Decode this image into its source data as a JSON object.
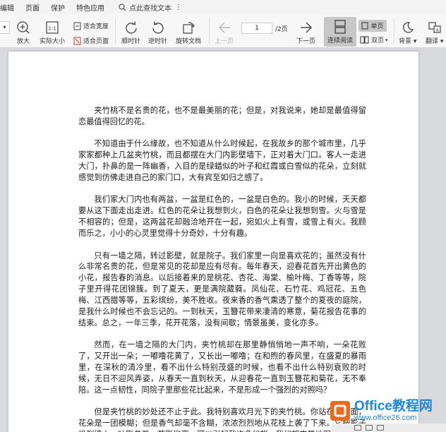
{
  "menubar": {
    "items": [
      "编辑",
      "页面",
      "保护",
      "特色应用"
    ],
    "search_label": "点此查找文本"
  },
  "toolbar": {
    "zoom_in": "放大",
    "actual_size": "实际大小",
    "fit_width": "适合宽度",
    "fit_page": "适合页面",
    "rotate_cw": "顺时针",
    "rotate_ccw": "逆时针",
    "rotate_doc": "旋转文档",
    "prev_page": "上一页",
    "page_current": "1",
    "page_total": "/2页",
    "next_page": "下一页",
    "continuous": "连续阅读",
    "single": "单页",
    "double": "双页",
    "background": "背景",
    "translate": "翻译"
  },
  "document": {
    "paragraphs": [
      "夹竹桃不是名贵的花，也不是最美丽的花；但是，对我说来，她却是最值得留恋最值得回忆的花。",
      "不知道由于什么缘故，也不知道从什么时候起，在我故乡的那个城市里，几乎家家都种上几盆夹竹桃，而且都摆在大门内影壁墙下，正对着大门口。客人一走进大门，扑鼻的是一阵幽香，入目的是绿蜡似的叶子和红霞或白雪似的花朵，立刻就感觉到仿佛走进自己的家门口，大有宾至如归之感了。",
      "我们家大门内也有两盆，一盆是红色的，一盆是白色的。我小的时候，天天都要从这下面走出走进。红色的花朵让我想到火，白色的花朵让我想到雪。火与雪是不相容的；但是，这两盆花却融洽地开在一起，宛如火上有雪，或雪上有火。我顾而乐之，小小的心灵里觉得十分奇妙，十分有趣。",
      "只有一墙之隔，转过影壁，就是院子。我们家里一向是喜欢花的；虽然没有什么非常名贵的花，但是常见的花却是应有尽有。每年春天，迎春花首先开出黄色的小花，报告春的消息。以后接着来的是桃花、杏花、海棠、榆叶梅、丁香等等，院子里开得花团锦簇。到了夏天，更是满院葳蕤。凤仙花、石竹花、鸡冠花、五色梅、江西腊等等，五彩缤纷，美不胜收。夜来香的香气熏透了整个的夏夜的庭院，是我什么时候也不会忘记的。一到秋天，玉簪花带来凄清的寒意，菊花报告花事的结束。总之，一年三季，花开花落，没有间歇；情景虽美，变化亦多。",
      "然而，在一墙之隔的大门内，夹竹桃却在那里静悄悄地一声不响，一朵花败了，又开出一朵；一嘟噜花黄了，又长出一嘟噜；在和煦的春风里，在盛夏的暴雨里，在深秋的清冷里，看不出什么特别茂盛的时候，也看不出什么特别衰败的时候，无日不迎风弄姿，从春天一直到秋天，从迎春花一直到玉簪花和菊花，无不奉陪。这一点韧性，同院子里那些花比起来，不是形成一个强烈的对照吗？",
      "但是夹竹桃的妙处还不止于此。我特别喜欢月光下的夹竹桃。你站在它下面，花朵是一团模糊；但是香气却毫不含糊，浓浓烈烈地从花枝上袭了下来。它把影子投到墙上，叶影参差，花影迷离，可以引起我许多幻想。我幻想它是地图，"
    ]
  },
  "watermark": {
    "title": "Office教程网",
    "url": "www.office26.com"
  },
  "colors": {
    "accent": "#1e88d6",
    "logo": "#ea6a1f",
    "toolbar_bg": "#f7f7f7",
    "viewport_bg": "#d9dade"
  }
}
